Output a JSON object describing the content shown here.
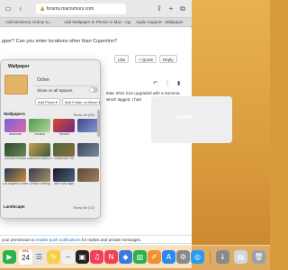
{
  "browser": {
    "url": "forums.macrumors.com",
    "tabs": [
      "Add Monterey Airdrop to...",
      "Add Wallpaper to Photos in Mac - Apple Support",
      "Apple Support - Wallpaper"
    ]
  },
  "thread": {
    "title_fragment": "pper? Can you enter locations other than Cupertino?",
    "buttons": {
      "like": "Like",
      "quote": "+ Quote",
      "reply": "Reply"
    },
    "body": "iMac 2011 21in upgraded with a Sonoma which lagged. I had"
  },
  "wallpaper": {
    "title": "Wallpaper",
    "current_name": "Ochre",
    "show_all_spaces": "Show on all Spaces",
    "add_photo": "Add Photo",
    "add_folder": "Add Folder or Album",
    "section_title": "Wallpapers",
    "show_all": "Show All (25)",
    "section_title_2": "Landscape",
    "show_all_2": "Show All (12)",
    "thumbs": [
      {
        "label": "Macintosh",
        "color1": "#7b5fd6",
        "color2": "#e06ba5"
      },
      {
        "label": "Sonoma",
        "color1": "#4a9a4a",
        "color2": "#b8d8a0"
      },
      {
        "label": "Ventura",
        "color1": "#d84a2a",
        "color2": "#6a2a8a"
      },
      {
        "label": "",
        "color1": "#3a4a8a",
        "color2": "#8a9ad8"
      },
      {
        "label": "Sonoma Horizon",
        "color1": "#2a4a2a",
        "color2": "#6a8a5a"
      },
      {
        "label": "California Golden Hour",
        "color1": "#c8a050",
        "color2": "#3a5a3a"
      },
      {
        "label": "Redwoods Fire",
        "color1": "#4a6a3a",
        "color2": "#8a6a3a"
      },
      {
        "label": "",
        "color1": "#3a4a5a",
        "color2": "#7a8a9a"
      },
      {
        "label": "Los Angeles Evening",
        "color1": "#2a3a5a",
        "color2": "#c89040"
      },
      {
        "label": "London Evening",
        "color1": "#3a3a4a",
        "color2": "#a89070"
      },
      {
        "label": "New York Night",
        "color1": "#1a1a2a",
        "color2": "#506080"
      },
      {
        "label": "",
        "color1": "#5a4a3a",
        "color2": "#a08060"
      }
    ]
  },
  "placeholder": {
    "text": "ilable"
  },
  "notification": {
    "prefix": "your permission to",
    "link": "enable push notifications",
    "suffix": "for replies and private messages."
  },
  "dock": {
    "date_month": "DEC",
    "date_day": "24",
    "icons": [
      {
        "name": "facetime-icon",
        "glyph": "▶",
        "color": "#2ab34a"
      },
      {
        "name": "reminders-icon",
        "glyph": "☰",
        "color": "#e5e5e5"
      },
      {
        "name": "notes-icon",
        "glyph": "✎",
        "color": "#f5d04a"
      },
      {
        "name": "freeform-icon",
        "glyph": "~",
        "color": "#f0f0f0"
      },
      {
        "name": "tv-icon",
        "glyph": "▣",
        "color": "#222"
      },
      {
        "name": "music-icon",
        "glyph": "♫",
        "color": "#f04060"
      },
      {
        "name": "news-icon",
        "glyph": "N",
        "color": "#f04050"
      },
      {
        "name": "keynote-icon",
        "glyph": "◆",
        "color": "#3a7ae0"
      },
      {
        "name": "numbers-icon",
        "glyph": "▥",
        "color": "#2ab34a"
      },
      {
        "name": "pages-icon",
        "glyph": "✐",
        "color": "#f09030"
      },
      {
        "name": "app-store-icon",
        "glyph": "A",
        "color": "#2a8af0"
      },
      {
        "name": "system-settings-icon",
        "glyph": "⚙",
        "color": "#8a8a8a"
      },
      {
        "name": "safari-icon",
        "glyph": "◎",
        "color": "#2a9af0"
      }
    ]
  }
}
